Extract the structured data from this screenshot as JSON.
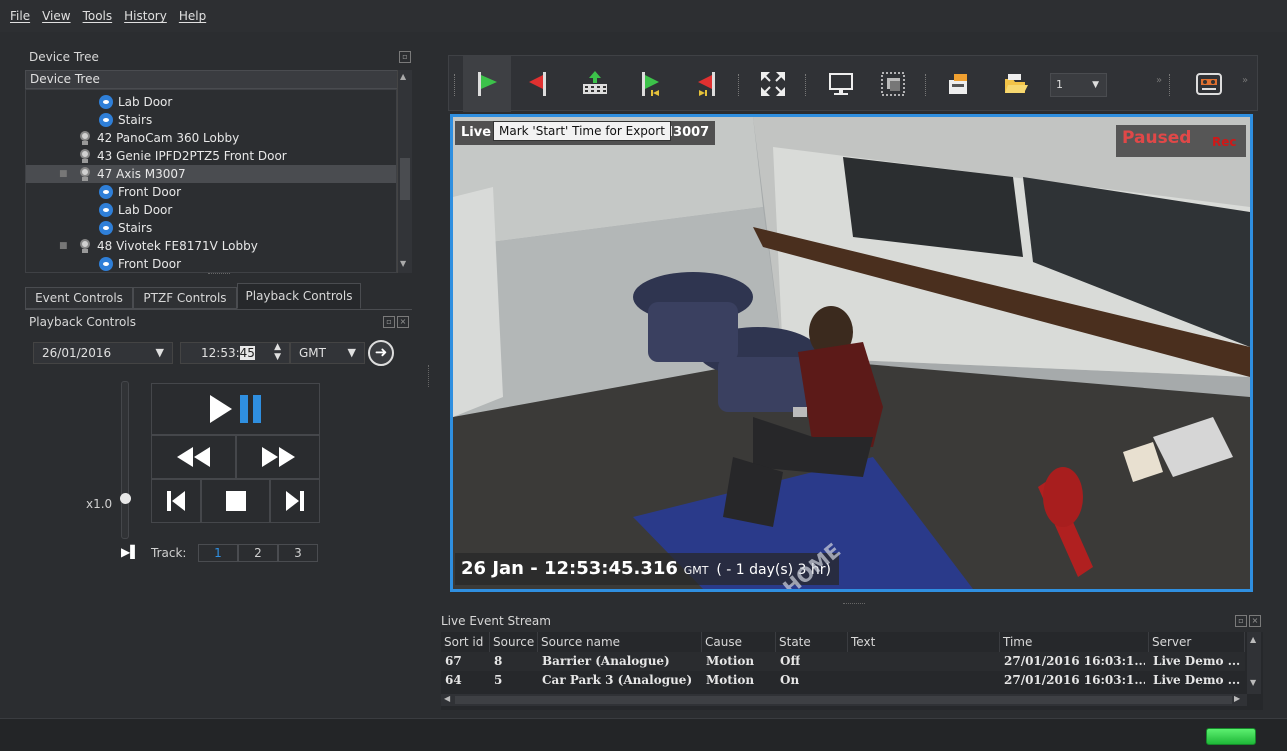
{
  "menu": [
    "File",
    "View",
    "Tools",
    "History",
    "Help"
  ],
  "device_tree": {
    "panel_title": "Device Tree",
    "selector": "Device Tree",
    "nodes": [
      {
        "label": "Lab Door",
        "type": "view"
      },
      {
        "label": "Stairs",
        "type": "view"
      },
      {
        "label": "42 PanoCam 360 Lobby",
        "type": "camera"
      },
      {
        "label": "43 Genie IPFD2PTZ5 Front Door",
        "type": "camera"
      },
      {
        "label": "47 Axis M3007",
        "type": "camera",
        "selected": true
      },
      {
        "label": "Front Door",
        "type": "view"
      },
      {
        "label": "Lab Door",
        "type": "view"
      },
      {
        "label": "Stairs",
        "type": "view"
      },
      {
        "label": "48 Vivotek FE8171V Lobby",
        "type": "camera"
      },
      {
        "label": "Front Door",
        "type": "view"
      }
    ]
  },
  "tabs": [
    "Event Controls",
    "PTZF Controls",
    "Playback Controls"
  ],
  "playback": {
    "panel_title": "Playback Controls",
    "date": "26/01/2016",
    "time_prefix": "12:53:",
    "time_seconds": "45",
    "timezone": "GMT",
    "speed": "x1.0",
    "track_label": "Track:",
    "tracks": [
      "1",
      "2",
      "3"
    ],
    "active_track": "1"
  },
  "toolbar": {
    "tooltip": "Mark 'Start' Time for Export",
    "layout_value": "1"
  },
  "video": {
    "overlay_prefix": "Live",
    "overlay_suffix": "M3007",
    "status": "Paused",
    "rec": "Rec",
    "timestamp": "26 Jan - 12:53:45.316",
    "tz": "GMT",
    "offset": "( - 1 day(s) 3 hr)",
    "floor_text": "HOME"
  },
  "event_stream": {
    "title": "Live Event Stream",
    "columns": [
      "Sort id",
      "Source",
      "Source name",
      "Cause",
      "State",
      "Text",
      "Time",
      "Server"
    ],
    "rows": [
      [
        "67",
        "8",
        "Barrier (Analogue)",
        "Motion",
        "Off",
        "",
        "27/01/2016 16:03:1...",
        "Live Demo ..."
      ],
      [
        "64",
        "5",
        "Car Park 3 (Analogue)",
        "Motion",
        "On",
        "",
        "27/01/2016 16:03:1...",
        "Live Demo ..."
      ]
    ]
  },
  "colors": {
    "accent": "#2f8fe0",
    "paused": "#e04848",
    "status_ok": "#2fd64a"
  }
}
